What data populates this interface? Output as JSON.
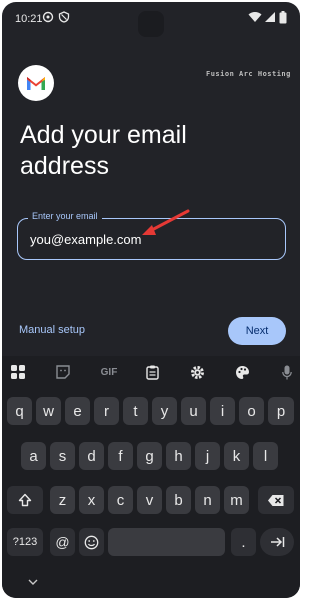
{
  "status_bar": {
    "time": "10:21"
  },
  "brand": {
    "tag": "Fusion Arc Hosting"
  },
  "setup": {
    "title": "Add your email address",
    "field_label": "Enter your email",
    "field_value": "you@example.com",
    "manual_setup": "Manual setup",
    "next": "Next"
  },
  "keyboard": {
    "toolbar": {
      "gif": "GIF"
    },
    "row1": [
      "q",
      "w",
      "e",
      "r",
      "t",
      "y",
      "u",
      "i",
      "o",
      "p"
    ],
    "row2": [
      "a",
      "s",
      "d",
      "f",
      "g",
      "h",
      "j",
      "k",
      "l"
    ],
    "row3": [
      "z",
      "x",
      "c",
      "v",
      "b",
      "n",
      "m"
    ],
    "symbols": "?123",
    "at": "@",
    "period": "."
  },
  "colors": {
    "accent": "#a8c7fa",
    "background": "#222328",
    "key": "#3a3b40",
    "arrow": "#e53935"
  }
}
